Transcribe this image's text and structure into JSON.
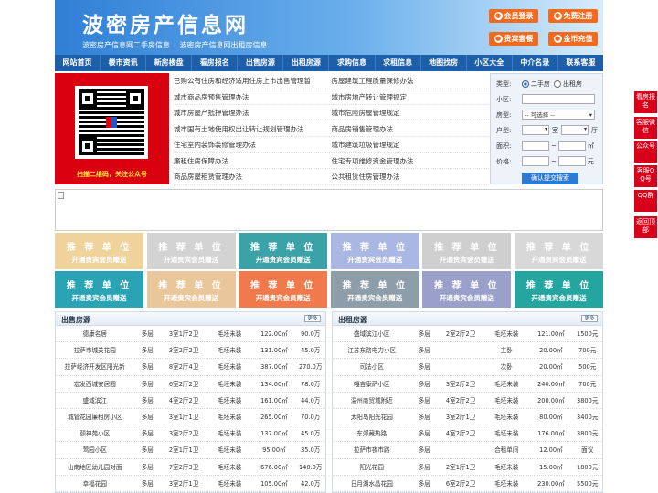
{
  "header": {
    "logo": "波密房产信息网",
    "sub1": "波密房产信息网二手房信息",
    "sub2": "波密房产信息网出租房信息",
    "btn_login": "会员登录",
    "btn_register": "免费注册",
    "btn_package": "贵宾套餐",
    "btn_recharge": "金币充值"
  },
  "nav": [
    "网站首页",
    "楼市资讯",
    "新房楼盘",
    "看房报名",
    "出售房源",
    "出租房源",
    "求购信息",
    "求租信息",
    "地图找房",
    "小区大全",
    "中介名录",
    "联系客服"
  ],
  "qr_text": "扫描二维码，关注公众号",
  "links": [
    [
      "已购公有住房和经济适用住房上市出售管理暂",
      "房屋建筑工程质量保修办法"
    ],
    [
      "城市商品房预售管理办法",
      "城市房地产转让管理规定"
    ],
    [
      "城市房屋产抵押管理办法",
      "城市危险房屋管理规定"
    ],
    [
      "城市国有土地使用权出让转让规划管理办法",
      "商品房销售管理办法"
    ],
    [
      "住宅室内装饰装修管理办法",
      "城市建筑垃圾管理规定"
    ],
    [
      "廉租住房保障办法",
      "住宅专项维修资金管理办法"
    ],
    [
      "商品房屋租赁管理办法",
      "公共租赁住房管理办法"
    ]
  ],
  "search": {
    "type_label": "类型:",
    "opt1": "二手房",
    "opt2": "出租房",
    "area_label": "小区:",
    "room_label": "房型:",
    "room_select": "-- 可选择 --",
    "huxing_label": "户型:",
    "shi": "室",
    "ting": "厅",
    "mianji_label": "面积:",
    "mianji_unit": "㎡",
    "price_label": "价格:",
    "price_unit": "元",
    "submit": "确认提交搜索"
  },
  "tiles": {
    "title": "推 荐 单 位",
    "sub": "开通贵宾会员赠送",
    "colors": [
      "#f0d39a",
      "#d3d3d3",
      "#3ba2a7",
      "#aab7e2",
      "#cfcfcf",
      "#d8d8d8",
      "#2aa3b5",
      "#eac79a",
      "#f07a4b",
      "#8e9ea8",
      "#9aa0c9",
      "#25a5a0"
    ]
  },
  "sale": {
    "title": "出售房源",
    "more": "更多",
    "rows": [
      [
        "德康名居",
        "多层",
        "3室1厅2卫",
        "毛坯未装",
        "122.00㎡",
        "90.0万"
      ],
      [
        "拉萨市城关花园",
        "多层",
        "3室2厅2卫",
        "毛坯未装",
        "131.00㎡",
        "45.0万"
      ],
      [
        "拉萨经济开发区阳光新",
        "多层",
        "8室2厅4卫",
        "毛坯未装",
        "387.00㎡",
        "270.0万"
      ],
      [
        "宏发西城安居园",
        "多层",
        "6室2厅2卫",
        "毛坯未装",
        "134.00㎡",
        "78.0万"
      ],
      [
        "盛域滨江",
        "多层",
        "4室2厅2卫",
        "毛坯未装",
        "161.00㎡",
        "44.0万"
      ],
      [
        "城管花园廉租房小区",
        "多层",
        "3室1厅1卫",
        "毛坯未装",
        "265.00㎡",
        "70.0万"
      ],
      [
        "颐神苑小区",
        "多层",
        "3室2厅2卫",
        "毛坯未装",
        "137.00㎡",
        "45.0万"
      ],
      [
        "莺园小区",
        "多层",
        "2室1厅1卫",
        "毛坯未装",
        "95.00㎡",
        "35.0万"
      ],
      [
        "山南地区幼儿园对面",
        "多层",
        "7室2厅3卫",
        "毛坯未装",
        "676.00㎡",
        "140.0万"
      ],
      [
        "幸福花园",
        "多层",
        "3室2厅1卫",
        "毛坯未装",
        "105.00㎡",
        "42.0万"
      ]
    ]
  },
  "rent": {
    "title": "出租房源",
    "more": "更多",
    "rows": [
      [
        "盛域滨江小区",
        "多层",
        "2室2厅2卫",
        "毛坯未装",
        "121.00㎡",
        "1500元"
      ],
      [
        "江苏东路电力小区",
        "多层",
        "",
        "主卧",
        "20.00㎡",
        "700元"
      ],
      [
        "司法小区",
        "多层",
        "",
        "次卧",
        "20.00㎡",
        "500元"
      ],
      [
        "嘎吉康萨小区",
        "多层",
        "3室2厅2卫",
        "毛坯未装",
        "240.00㎡",
        "700元"
      ],
      [
        "温州商贸城附近",
        "多层",
        "4室2厅2卫",
        "毛坯未装",
        "200.00㎡",
        "3800元"
      ],
      [
        "太阳岛阳光花园",
        "多层",
        "3室2厅1卫",
        "毛坯未装",
        "80.00㎡",
        "3400元"
      ],
      [
        "东郊藏热路",
        "多层",
        "4室2厅2卫",
        "毛坯未装",
        "176.00㎡",
        "3800元"
      ],
      [
        "拉萨市夜市路",
        "多层",
        "",
        "合租单间",
        "12.00㎡",
        "面议"
      ],
      [
        "阳光花园",
        "多层",
        "2室1厅1卫",
        "毛坯未装",
        "15.00㎡",
        "1800元"
      ],
      [
        "日月湖水晶花园",
        "多层",
        "6室2厅2卫",
        "毛坯未装",
        "230.00㎡",
        "5500元"
      ]
    ]
  },
  "side": [
    "看房报名",
    "客服微信",
    "公众号",
    "客服QQ号",
    "QQ群",
    "返回顶部"
  ]
}
